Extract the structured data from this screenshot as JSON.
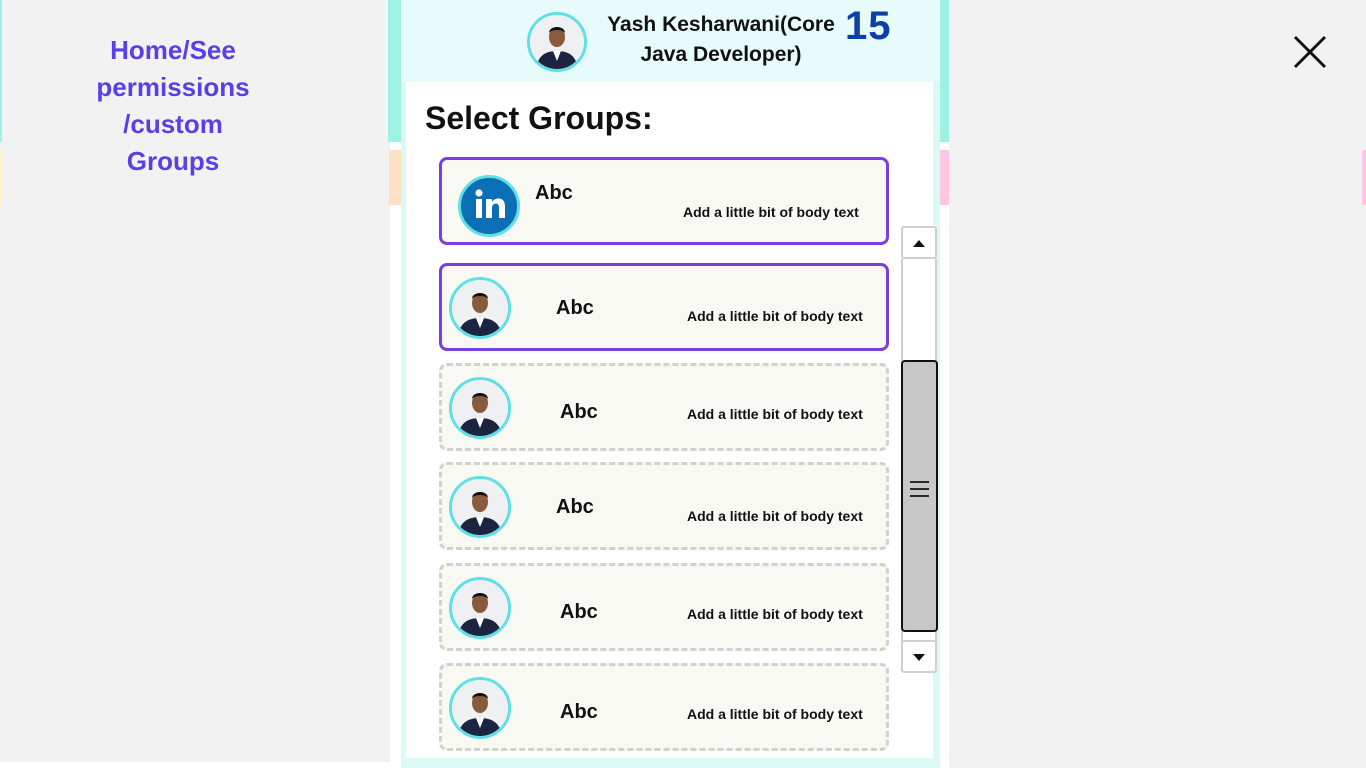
{
  "breadcrumb": {
    "line1": "Home/See",
    "line2": "permissions",
    "line3": "/custom",
    "line4": "Groups"
  },
  "header": {
    "name_line1": "Yash Kesharwani(Core",
    "name_line2": "Java Developer)",
    "count": "15",
    "avatar_icon": "person-avatar-icon"
  },
  "main": {
    "title": "Select Groups:"
  },
  "groups": [
    {
      "title": "Abc",
      "body": "Add a little bit of body text",
      "icon": "linkedin-icon",
      "selected": true
    },
    {
      "title": "Abc",
      "body": "Add a little bit of body text",
      "icon": "person-avatar-icon",
      "selected": true
    },
    {
      "title": "Abc",
      "body": "Add a little bit of body text",
      "icon": "person-avatar-icon",
      "selected": false
    },
    {
      "title": "Abc",
      "body": "Add a little bit of body text",
      "icon": "person-avatar-icon",
      "selected": false
    },
    {
      "title": "Abc",
      "body": "Add a little bit of body text",
      "icon": "person-avatar-icon",
      "selected": false
    },
    {
      "title": "Abc",
      "body": "Add a little bit of body text",
      "icon": "person-avatar-icon",
      "selected": false
    }
  ],
  "colors": {
    "accent_purple": "#7a3ee0",
    "breadcrumb": "#5b3fe6",
    "count_blue": "#0d3fa8",
    "avatar_ring": "#5ee0e6",
    "panel_teal": "#9ef2e4"
  }
}
